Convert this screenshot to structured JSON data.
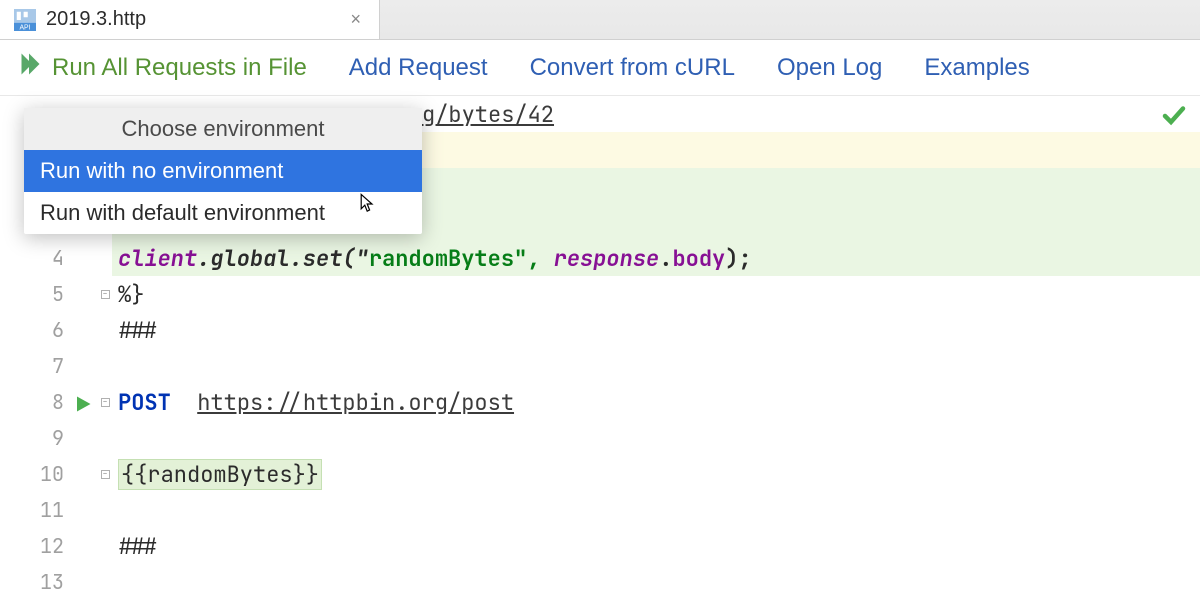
{
  "tab": {
    "filename": "2019.3.http",
    "close_glyph": "×"
  },
  "actions": {
    "run_all": "Run All Requests in File",
    "add_request": "Add Request",
    "convert_curl": "Convert from cURL",
    "open_log": "Open Log",
    "examples": "Examples"
  },
  "popup": {
    "header": "Choose environment",
    "opt_none": "Run with no environment",
    "opt_default": "Run with default environment"
  },
  "gutter": {
    "l4": "4",
    "l5": "5",
    "l6": "6",
    "l7": "7",
    "l8": "8",
    "l9": "9",
    "l10": "10",
    "l11": "11",
    "l12": "12",
    "l13": "13"
  },
  "code": {
    "line1_url_frag": "g/bytes/42",
    "line4_a": "client",
    "line4_b": ".global.set(\"",
    "line4_c": "randomBytes\", ",
    "line4_d": "response",
    "line4_e": ".",
    "line4_f": "body",
    "line4_g": ");",
    "line5": "%}",
    "line6": "###",
    "line8_kw": "POST",
    "line8_sp": "  ",
    "line8_url": "https://httpbin.org/post",
    "line10": "{{randomBytes}}",
    "line12": "###"
  }
}
